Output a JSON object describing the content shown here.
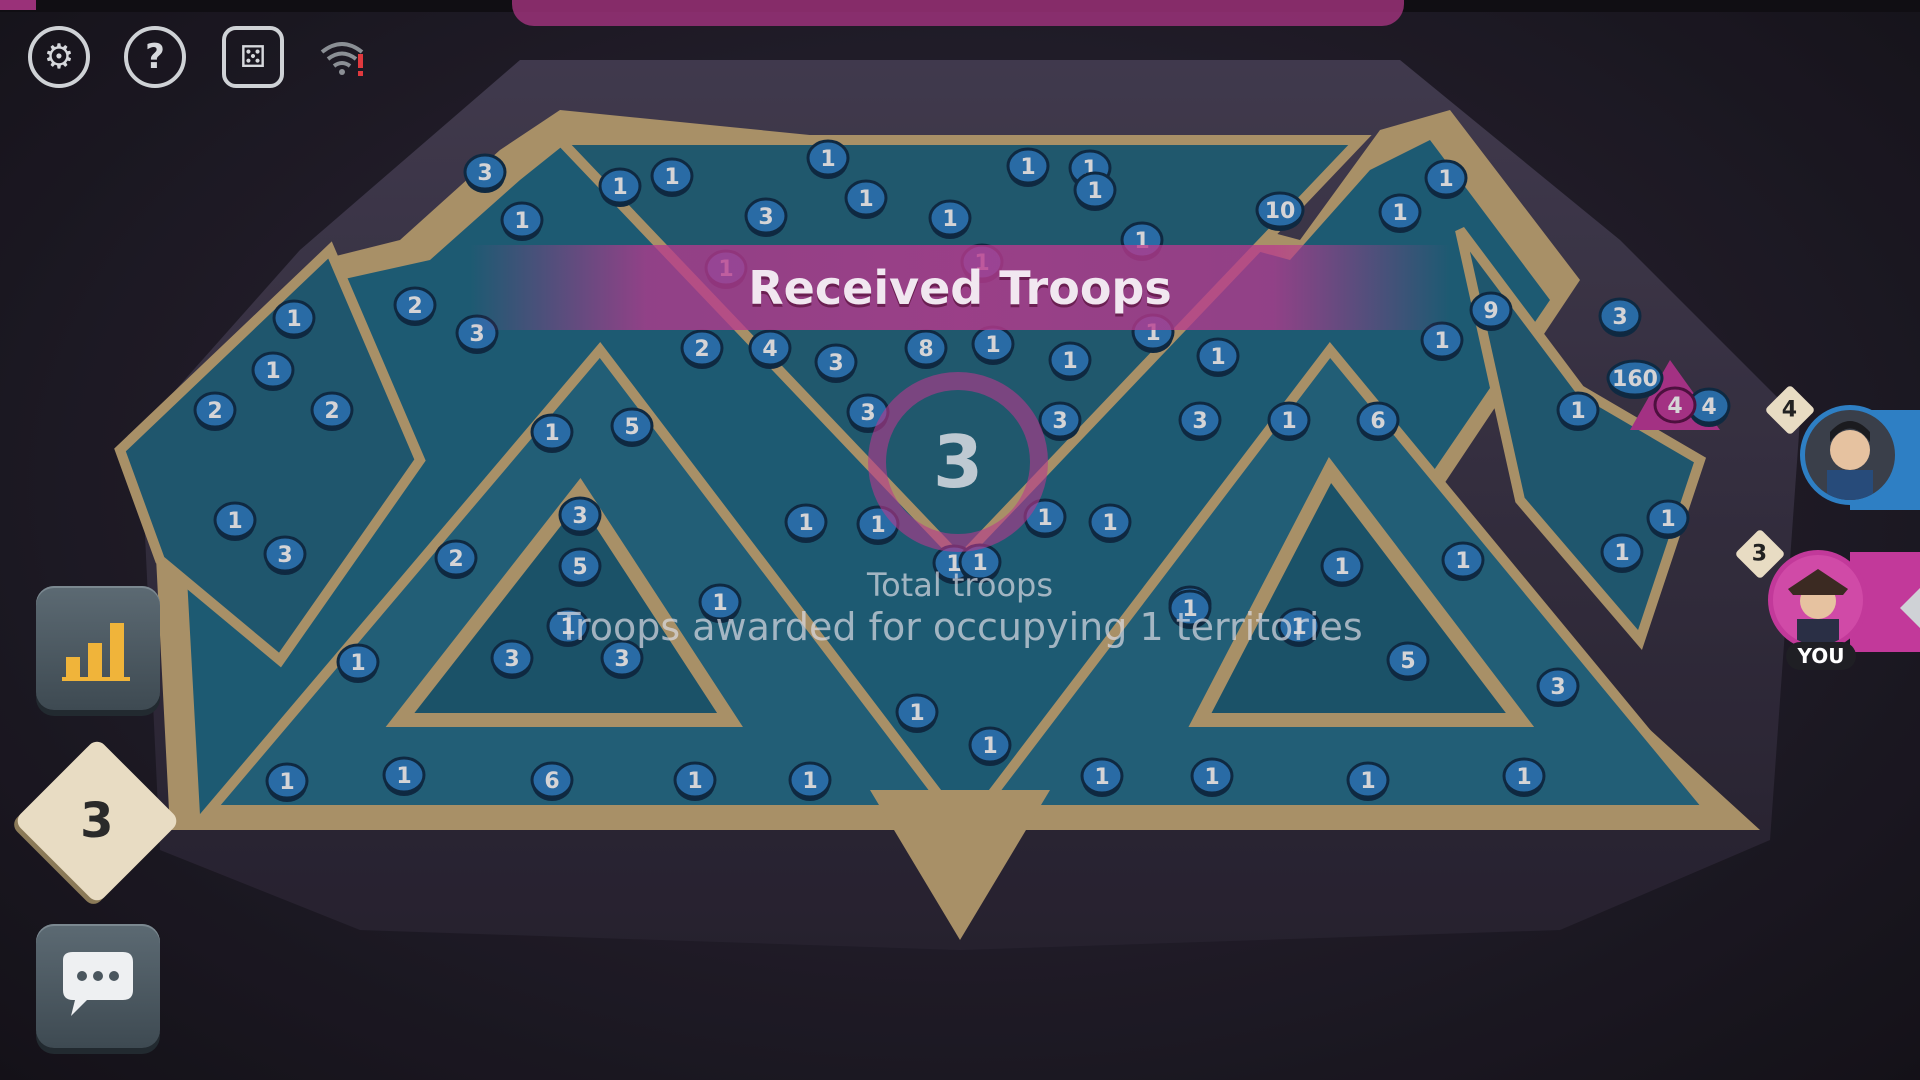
{
  "overlay": {
    "title": "Received Troops",
    "total_value": "3",
    "total_label": "Total troops",
    "award_text": "Troops awarded for occupying 1 territories"
  },
  "controls": {
    "settings_icon": "gear-icon",
    "help_icon": "question-icon",
    "dice_icon": "dice-icon",
    "network_icon": "wifi-warning-icon",
    "stats_icon": "bar-chart-icon",
    "cards_count": "3",
    "chat_icon": "chat-bubble-icon"
  },
  "players": [
    {
      "name": "opponent",
      "cards": "4",
      "color": "#2e7fc4"
    },
    {
      "name": "you",
      "label": "YOU",
      "cards": "3",
      "color": "#c2399a"
    }
  ],
  "colors": {
    "blue_player": "#2e7fc4",
    "pink_player": "#c2399a",
    "board_teal": "#1f6b86",
    "wall_gold": "#c9ad78"
  },
  "board": {
    "counters": [
      "3",
      "1",
      "1",
      "1",
      "1",
      "1",
      "1",
      "1",
      "1",
      "10",
      "1",
      "1",
      "3",
      "1",
      "1",
      "1",
      "1",
      "2",
      "1",
      "3",
      "2",
      "4",
      "3",
      "8",
      "1",
      "1",
      "1",
      "1",
      "9",
      "3",
      "1",
      "160",
      "4",
      "1",
      "2",
      "2",
      "1",
      "5",
      "3",
      "1",
      "6",
      "1",
      "3",
      "3",
      "3",
      "2",
      "3",
      "1",
      "1",
      "1",
      "1",
      "1",
      "1",
      "5",
      "1",
      "1",
      "1",
      "1",
      "1",
      "3",
      "3",
      "1",
      "1",
      "1",
      "1",
      "5",
      "3",
      "1",
      "1",
      "1",
      "1",
      "1",
      "6",
      "1",
      "1",
      "1",
      "1",
      "1",
      "1",
      "1"
    ],
    "pink_territory_count": "4"
  }
}
